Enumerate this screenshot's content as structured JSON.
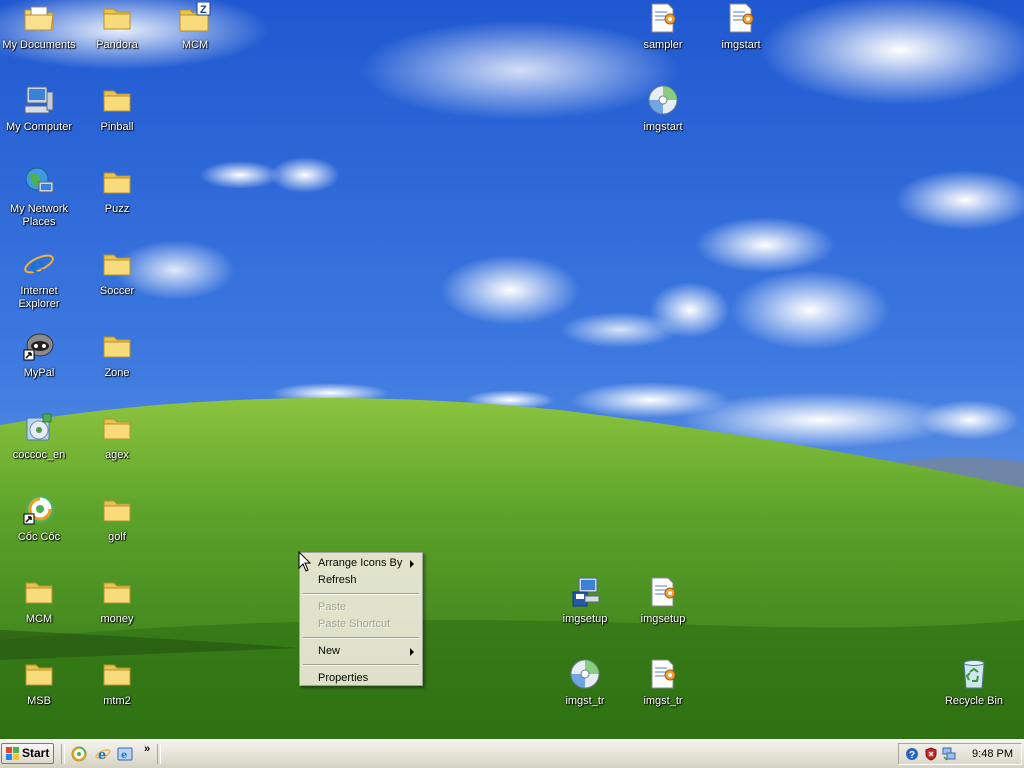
{
  "desktop": {
    "left_column": [
      {
        "label": "My Documents",
        "icon": "my-documents-icon"
      },
      {
        "label": "My Computer",
        "icon": "my-computer-icon"
      },
      {
        "label": "My Network Places",
        "icon": "network-places-icon"
      },
      {
        "label": "Internet Explorer",
        "icon": "internet-explorer-icon"
      },
      {
        "label": "MyPal",
        "icon": "mypal-icon"
      },
      {
        "label": "coccoc_en",
        "icon": "installer-disc-icon"
      },
      {
        "label": "Cốc Cốc",
        "icon": "coccoc-browser-icon"
      },
      {
        "label": "MCM",
        "icon": "folder-icon"
      },
      {
        "label": "MSB",
        "icon": "folder-icon"
      }
    ],
    "second_column": [
      {
        "label": "Pandora",
        "icon": "folder-icon"
      },
      {
        "label": "Pinball",
        "icon": "folder-icon"
      },
      {
        "label": "Puzz",
        "icon": "folder-icon"
      },
      {
        "label": "Soccer",
        "icon": "folder-icon"
      },
      {
        "label": "Zone",
        "icon": "folder-icon"
      },
      {
        "label": "agex",
        "icon": "folder-icon"
      },
      {
        "label": "golf",
        "icon": "folder-icon"
      },
      {
        "label": "money",
        "icon": "folder-icon"
      },
      {
        "label": "mtm2",
        "icon": "folder-icon"
      }
    ],
    "mcm_zip": {
      "label": "MCM",
      "icon": "zip-folder-icon"
    },
    "top_right": [
      {
        "label": "sampler",
        "icon": "settings-file-icon"
      },
      {
        "label": "imgstart",
        "icon": "settings-file-icon"
      },
      {
        "label": "imgstart",
        "icon": "cd-icon"
      }
    ],
    "bottom_group": [
      {
        "label": "imgsetup",
        "icon": "setup-computer-icon"
      },
      {
        "label": "imgsetup",
        "icon": "settings-file-icon"
      },
      {
        "label": "imgst_tr",
        "icon": "cd-icon"
      },
      {
        "label": "imgst_tr",
        "icon": "settings-file-icon"
      }
    ],
    "recycle_bin": {
      "label": "Recycle Bin",
      "icon": "recycle-bin-icon"
    }
  },
  "context_menu": {
    "arrange": "Arrange Icons By",
    "refresh": "Refresh",
    "paste": "Paste",
    "paste_shortcut": "Paste Shortcut",
    "new": "New",
    "properties": "Properties"
  },
  "taskbar": {
    "start_label": "Start",
    "quick_launch": [
      "coccoc-icon",
      "internet-explorer-icon",
      "show-desktop-icon"
    ],
    "overflow": "»",
    "tray_icons": [
      "help-icon",
      "shield-icon",
      "network-icon"
    ],
    "clock": "9:48 PM"
  },
  "colors": {
    "sky": "#2f68d6",
    "grass": "#3f8a1c",
    "taskbar": "#ece9d8"
  }
}
